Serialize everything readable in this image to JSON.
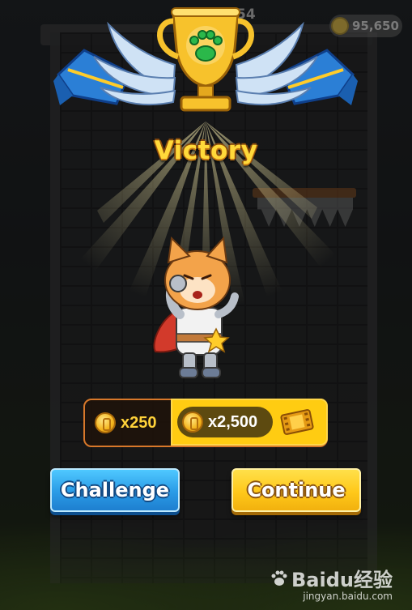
{
  "hud": {
    "level": "54",
    "coins": "95,650"
  },
  "title": "Victory",
  "reward": {
    "base_amount": "x250",
    "bonus_amount": "x2,500"
  },
  "buttons": {
    "challenge": "Challenge",
    "continue": "Continue"
  },
  "icons": {
    "trophy": "trophy-with-paw-icon",
    "coin": "gold-coin-icon",
    "ticket": "video-ticket-icon",
    "character": "cat-knight-character"
  },
  "watermark": {
    "brand": "Baidu经验",
    "site": "jingyan.baidu.com"
  },
  "colors": {
    "victory_text": "#ffd93a",
    "challenge_button": "#2a9be6",
    "continue_button": "#ffc81a",
    "reward_border": "#d8782a"
  }
}
